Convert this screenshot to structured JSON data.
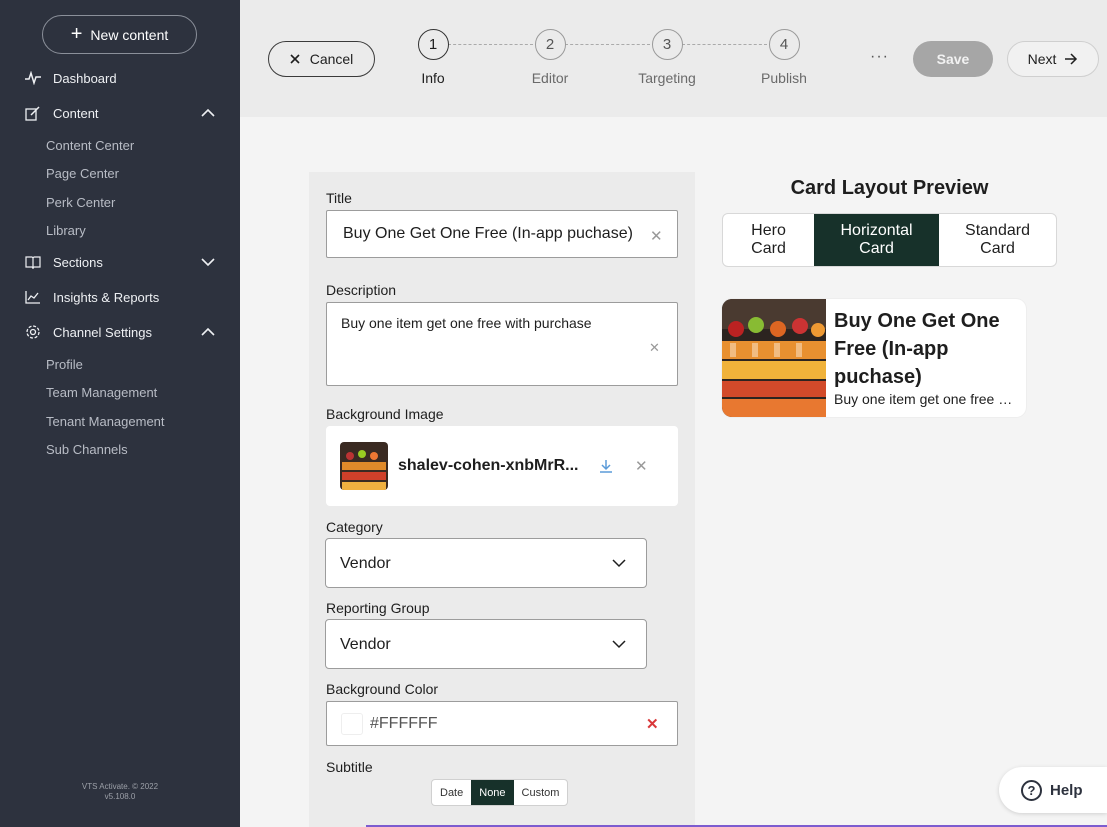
{
  "sidebar": {
    "new_content_label": "New content",
    "items": [
      {
        "label": "Dashboard",
        "icon": "pulse-icon"
      },
      {
        "label": "Content",
        "icon": "edit-icon",
        "expanded": true
      },
      {
        "label": "Sections",
        "icon": "book-icon",
        "expanded": false
      },
      {
        "label": "Insights & Reports",
        "icon": "chart-icon"
      },
      {
        "label": "Channel Settings",
        "icon": "gear-icon",
        "expanded": true
      }
    ],
    "content_sub": [
      "Content Center",
      "Page Center",
      "Perk Center",
      "Library"
    ],
    "channel_sub": [
      "Profile",
      "Team Management",
      "Tenant Management",
      "Sub Channels"
    ],
    "footer_line1": "VTS Activate. © 2022",
    "footer_line2": "v5.108.0"
  },
  "topbar": {
    "cancel_label": "Cancel",
    "steps": [
      {
        "num": "1",
        "label": "Info",
        "active": true
      },
      {
        "num": "2",
        "label": "Editor",
        "active": false
      },
      {
        "num": "3",
        "label": "Targeting",
        "active": false
      },
      {
        "num": "4",
        "label": "Publish",
        "active": false
      }
    ],
    "more_label": "···",
    "save_label": "Save",
    "next_label": "Next"
  },
  "form": {
    "title_label": "Title",
    "title_value": "Buy One Get One Free (In-app puchase)",
    "description_label": "Description",
    "description_value": "Buy one item get one free with purchase",
    "bg_image_label": "Background Image",
    "bg_image_name": "shalev-cohen-xnbMrR...",
    "category_label": "Category",
    "category_value": "Vendor",
    "reporting_label": "Reporting Group",
    "reporting_value": "Vendor",
    "bg_color_label": "Background Color",
    "bg_color_value": "#FFFFFF",
    "subtitle_label": "Subtitle",
    "subtitle_options": [
      "Date",
      "None",
      "Custom"
    ],
    "subtitle_selected": "None"
  },
  "preview": {
    "title": "Card Layout Preview",
    "tabs": [
      {
        "line1": "Hero",
        "line2": "Card"
      },
      {
        "line1": "Horizontal",
        "line2": "Card"
      },
      {
        "line1": "Standard",
        "line2": "Card"
      }
    ],
    "selected_tab": "Horizontal Card",
    "card_title": "Buy One Get One Free (In-app puchase)",
    "card_desc": "Buy one item get one free with purchase"
  },
  "help_label": "Help",
  "colors": {
    "sidebar_bg": "#2d323e",
    "accent_dark_green": "#17312a",
    "danger": "#d9383a"
  }
}
